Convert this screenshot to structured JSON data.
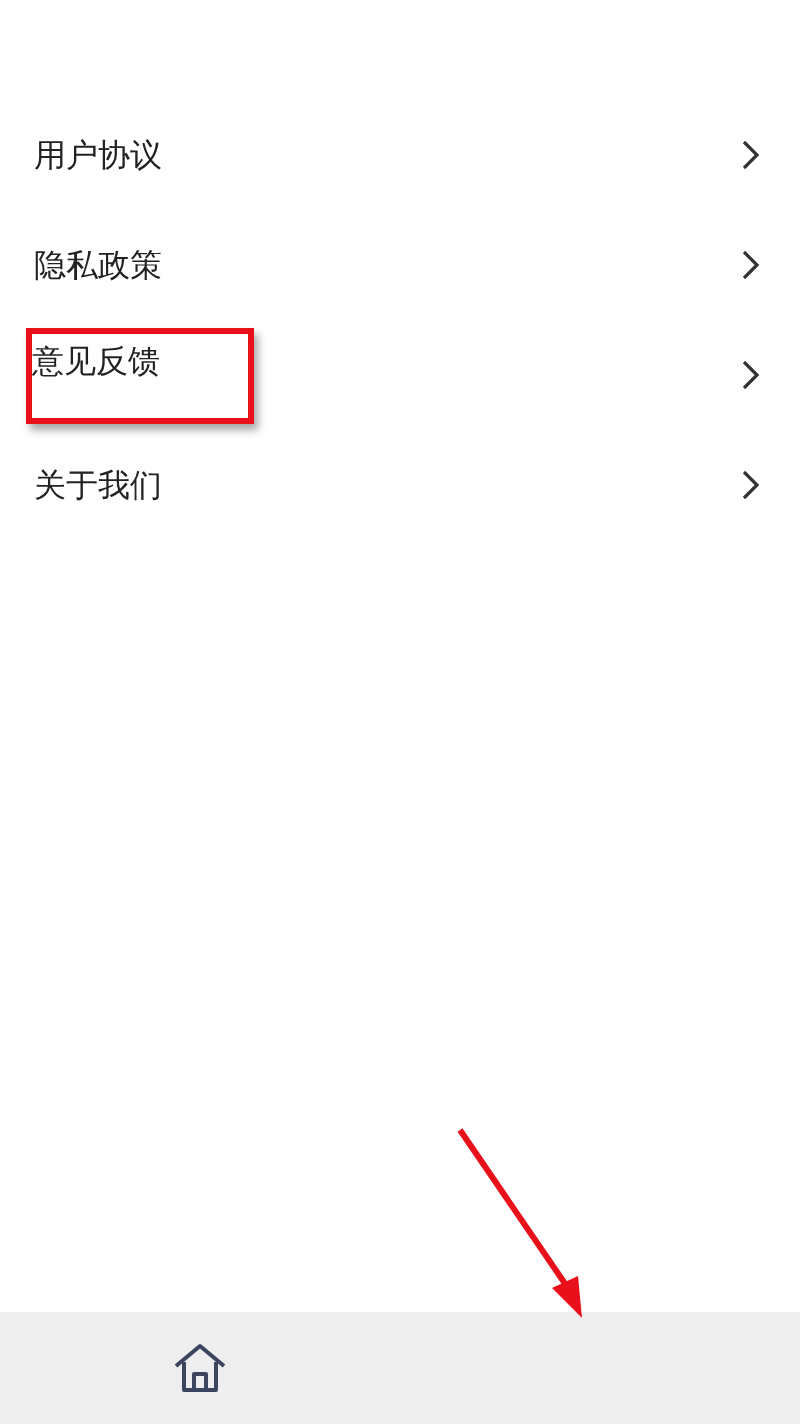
{
  "menu": [
    {
      "label": "用户协议",
      "highlighted": false
    },
    {
      "label": "隐私政策",
      "highlighted": false
    },
    {
      "label": "意见反馈",
      "highlighted": true
    },
    {
      "label": "关于我们",
      "highlighted": false
    }
  ],
  "annotation_arrow": true,
  "tab_bar": {
    "items": [
      {
        "kind": "home"
      }
    ]
  }
}
